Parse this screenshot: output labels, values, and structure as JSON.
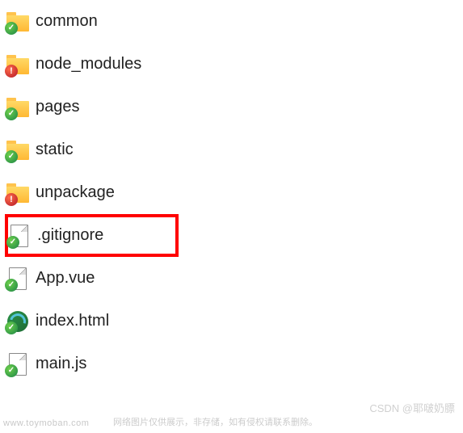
{
  "files": [
    {
      "name": "common",
      "type": "folder",
      "status": "ok"
    },
    {
      "name": "node_modules",
      "type": "folder",
      "status": "error"
    },
    {
      "name": "pages",
      "type": "folder",
      "status": "ok"
    },
    {
      "name": "static",
      "type": "folder",
      "status": "ok"
    },
    {
      "name": "unpackage",
      "type": "folder",
      "status": "error"
    },
    {
      "name": ".gitignore",
      "type": "file",
      "status": "ok",
      "highlighted": true
    },
    {
      "name": "App.vue",
      "type": "vue",
      "status": "ok"
    },
    {
      "name": "index.html",
      "type": "html",
      "status": "ok"
    },
    {
      "name": "main.js",
      "type": "file",
      "status": "ok"
    }
  ],
  "watermarks": {
    "left": "www.toymoban.com",
    "center": "网络图片仅供展示，非存储，如有侵权请联系删除。",
    "right": "CSDN @耶啵奶膘"
  }
}
